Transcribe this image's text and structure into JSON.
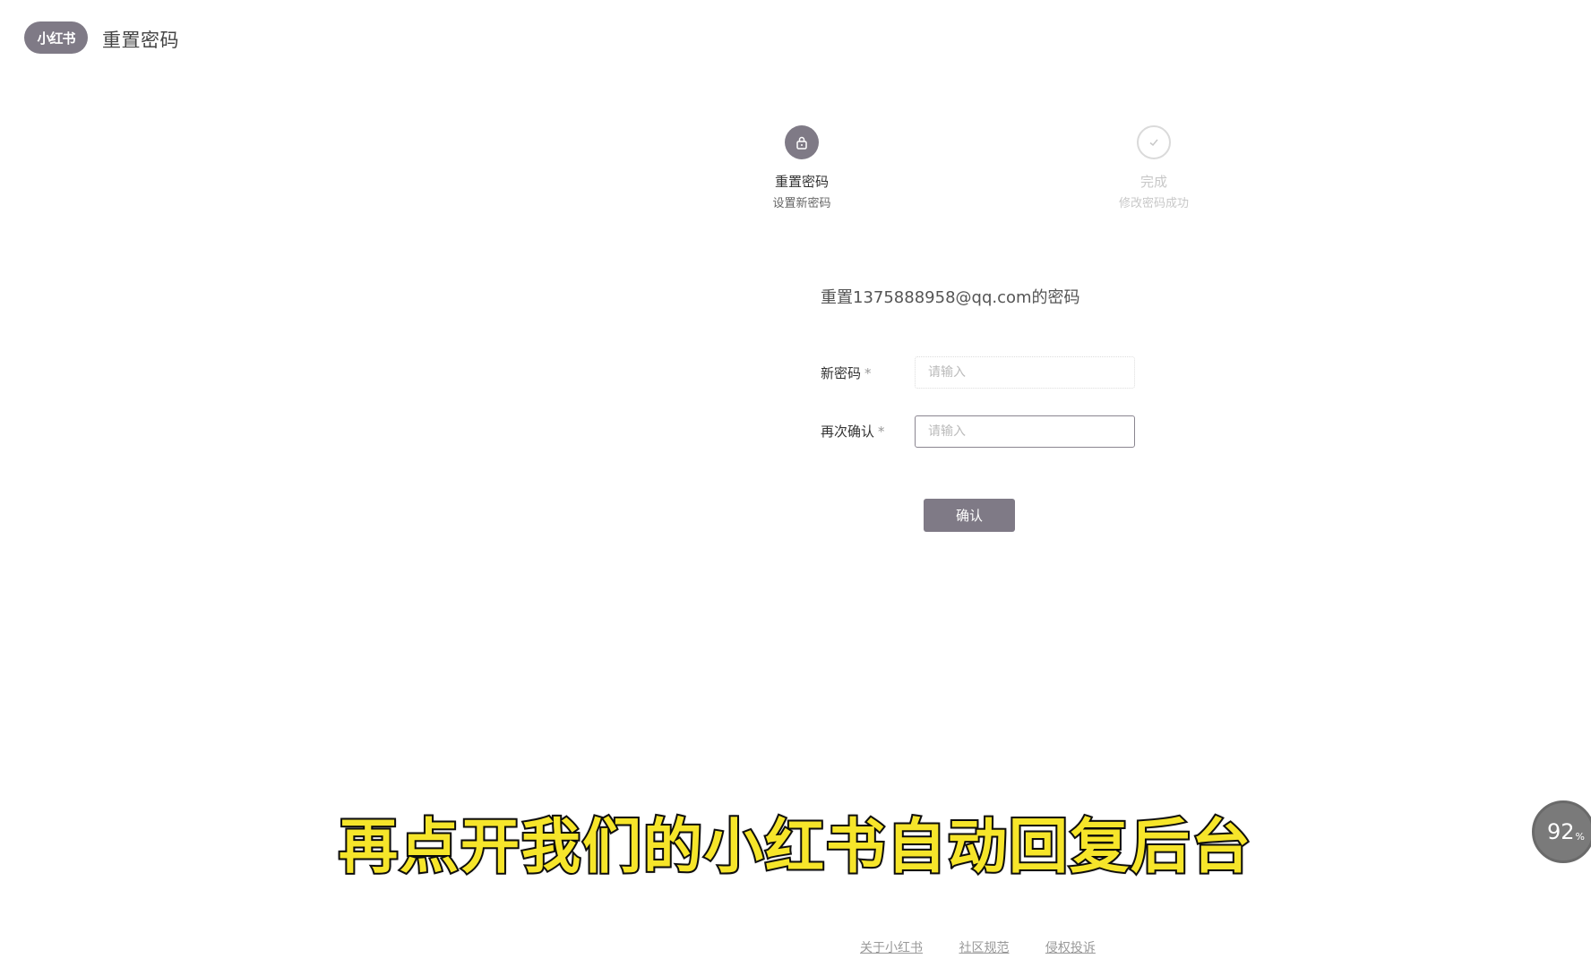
{
  "header": {
    "logo_text": "小红书",
    "title": "重置密码"
  },
  "steps": [
    {
      "title": "重置密码",
      "desc": "设置新密码",
      "icon": "lock-icon",
      "state": "active"
    },
    {
      "title": "完成",
      "desc": "修改密码成功",
      "icon": "check-icon",
      "state": "pending"
    }
  ],
  "form": {
    "heading": "重置1375888958@qq.com的密码",
    "new_password_label": "新密码",
    "confirm_label": "再次确认",
    "required_mark": "*",
    "new_password_placeholder": "请输入",
    "confirm_placeholder": "请输入",
    "submit_label": "确认"
  },
  "caption": "再点开我们的小红书自动回复后台",
  "zoom": {
    "value": "92",
    "unit": "%"
  },
  "footer": {
    "links": [
      "关于小红书",
      "社区规范",
      "侵权投诉"
    ]
  },
  "colors": {
    "accent": "#7f7a86",
    "caption_text": "#f6e52a"
  }
}
